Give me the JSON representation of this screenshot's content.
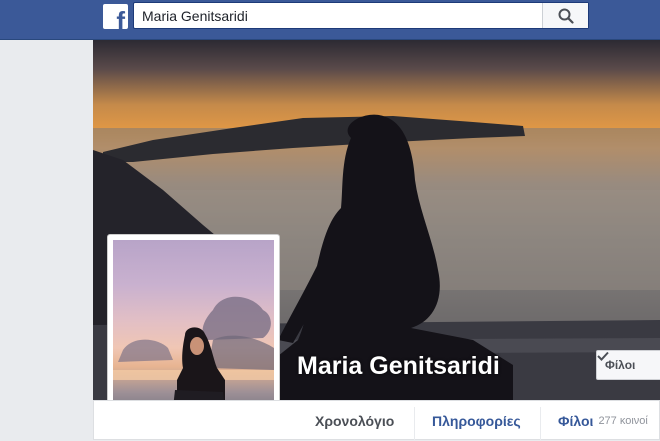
{
  "header": {
    "logo_letter": "f",
    "search": {
      "value": "Maria Genitsaridi"
    }
  },
  "profile": {
    "name": "Maria Genitsaridi",
    "friends_button_label": "Φίλοι"
  },
  "nav": {
    "timeline_label": "Χρονολόγιο",
    "about_label": "Πληροφορίες",
    "friends_label": "Φίλοι",
    "friends_count": "277 κοινοί"
  },
  "colors": {
    "brand_blue": "#3b5998",
    "link_blue": "#365899",
    "page_bg": "#e9ebee"
  }
}
